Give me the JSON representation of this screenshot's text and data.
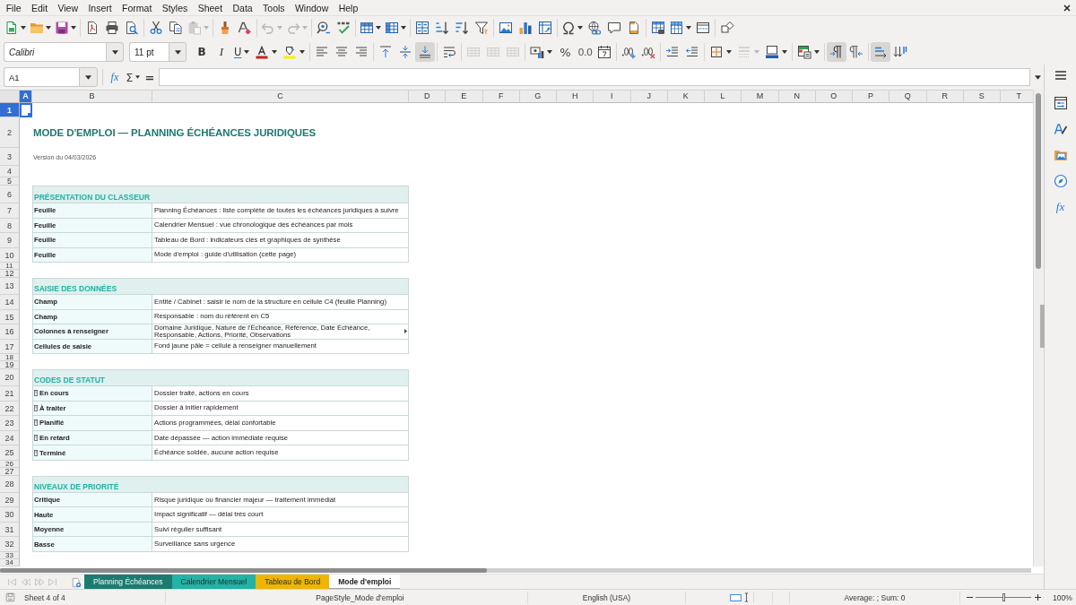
{
  "menu_bar": [
    "File",
    "Edit",
    "View",
    "Insert",
    "Format",
    "Styles",
    "Sheet",
    "Data",
    "Tools",
    "Window",
    "Help"
  ],
  "standard_toolbar": [
    {
      "kind": "split",
      "disabled": false
    },
    {
      "kind": "split",
      "disabled": false
    },
    {
      "kind": "split",
      "disabled": false
    },
    {
      "kind": "button",
      "disabled": false
    },
    {
      "kind": "button",
      "disabled": false
    },
    {
      "kind": "button",
      "disabled": false
    },
    {
      "kind": "button",
      "disabled": false
    },
    {
      "kind": "button",
      "disabled": false
    },
    {
      "kind": "split",
      "disabled": true
    },
    {
      "kind": "button",
      "disabled": false
    },
    {
      "kind": "button",
      "disabled": false
    },
    {
      "kind": "split",
      "disabled": true
    },
    {
      "kind": "split",
      "disabled": true
    },
    {
      "kind": "button",
      "disabled": false
    },
    {
      "kind": "button",
      "disabled": false
    },
    {
      "kind": "split",
      "disabled": false
    },
    {
      "kind": "split",
      "disabled": false
    },
    {
      "kind": "button",
      "disabled": false
    },
    {
      "kind": "button",
      "disabled": false
    },
    {
      "kind": "button",
      "disabled": false
    },
    {
      "kind": "button",
      "disabled": false
    },
    {
      "kind": "button",
      "disabled": false
    },
    {
      "kind": "button",
      "disabled": false
    },
    {
      "kind": "button",
      "disabled": false
    },
    {
      "kind": "split",
      "disabled": false
    },
    {
      "kind": "button",
      "disabled": false
    },
    {
      "kind": "button",
      "disabled": false
    },
    {
      "kind": "button",
      "disabled": false
    },
    {
      "kind": "button",
      "disabled": false
    },
    {
      "kind": "split",
      "disabled": false
    },
    {
      "kind": "button",
      "disabled": false
    },
    {
      "kind": "button",
      "disabled": false
    }
  ],
  "formatting_toolbar": {
    "font_name": "Calibri",
    "font_size": "11 pt",
    "buttons": [
      {
        "kind": "button",
        "label": "B",
        "disabled": false,
        "pressed": false
      },
      {
        "kind": "button",
        "label": "I",
        "disabled": false,
        "pressed": false
      },
      {
        "kind": "split",
        "label": "U",
        "disabled": false,
        "pressed": false
      },
      {
        "kind": "split",
        "disabled": false,
        "pressed": false
      },
      {
        "kind": "split",
        "disabled": false,
        "pressed": false
      },
      {
        "kind": "button",
        "disabled": false,
        "pressed": false
      },
      {
        "kind": "button",
        "disabled": false,
        "pressed": false
      },
      {
        "kind": "button",
        "disabled": false,
        "pressed": false
      },
      {
        "kind": "button",
        "disabled": false,
        "pressed": false
      },
      {
        "kind": "button",
        "disabled": false,
        "pressed": false
      },
      {
        "kind": "button",
        "disabled": false,
        "pressed": true
      },
      {
        "kind": "button",
        "disabled": false,
        "pressed": false
      },
      {
        "kind": "button",
        "disabled": true,
        "pressed": false
      },
      {
        "kind": "button",
        "disabled": true,
        "pressed": false
      },
      {
        "kind": "button",
        "disabled": true,
        "pressed": false
      },
      {
        "kind": "split",
        "disabled": false,
        "pressed": false
      },
      {
        "kind": "button",
        "label": "%",
        "disabled": false,
        "pressed": false
      },
      {
        "kind": "button",
        "label": "0.0",
        "disabled": false,
        "pressed": false
      },
      {
        "kind": "button",
        "disabled": false,
        "pressed": false
      },
      {
        "kind": "button",
        "disabled": false,
        "pressed": false
      },
      {
        "kind": "button",
        "disabled": false,
        "pressed": false
      },
      {
        "kind": "button",
        "disabled": false,
        "pressed": false
      },
      {
        "kind": "button",
        "disabled": false,
        "pressed": false
      },
      {
        "kind": "split",
        "disabled": false,
        "pressed": false
      },
      {
        "kind": "split",
        "disabled": true,
        "pressed": false
      },
      {
        "kind": "split",
        "disabled": false,
        "pressed": false
      },
      {
        "kind": "split",
        "disabled": false,
        "pressed": false
      },
      {
        "kind": "button",
        "disabled": false,
        "pressed": true
      },
      {
        "kind": "button",
        "disabled": false,
        "pressed": false
      },
      {
        "kind": "button",
        "disabled": false,
        "pressed": true
      },
      {
        "kind": "button",
        "disabled": false,
        "pressed": false
      }
    ]
  },
  "formula_bar": {
    "name_box": "A1",
    "function_wizard": "fx",
    "sum": "Σ",
    "equals": "="
  },
  "sheet": {
    "columns": [
      {
        "label": "A",
        "selected": true
      },
      {
        "label": "B",
        "selected": false
      },
      {
        "label": "C",
        "selected": false
      },
      {
        "label": "D",
        "selected": false
      },
      {
        "label": "E",
        "selected": false
      },
      {
        "label": "F",
        "selected": false
      },
      {
        "label": "G",
        "selected": false
      },
      {
        "label": "H",
        "selected": false
      },
      {
        "label": "I",
        "selected": false
      },
      {
        "label": "J",
        "selected": false
      },
      {
        "label": "K",
        "selected": false
      },
      {
        "label": "L",
        "selected": false
      },
      {
        "label": "M",
        "selected": false
      },
      {
        "label": "N",
        "selected": false
      },
      {
        "label": "O",
        "selected": false
      },
      {
        "label": "P",
        "selected": false
      },
      {
        "label": "Q",
        "selected": false
      },
      {
        "label": "R",
        "selected": false
      },
      {
        "label": "S",
        "selected": false
      },
      {
        "label": "T",
        "selected": false
      }
    ],
    "rows": [
      {
        "number": "1",
        "selected": true,
        "kind": "blank"
      },
      {
        "number": "2",
        "selected": false,
        "kind": "title",
        "text": "MODE D'EMPLOI — PLANNING ÉCHÉANCES JURIDIQUES"
      },
      {
        "number": "3",
        "selected": false,
        "kind": "version",
        "text": "Version du 04/03/2026"
      },
      {
        "number": "4",
        "selected": false,
        "kind": "blank"
      },
      {
        "number": "5",
        "selected": false,
        "kind": "blank"
      },
      {
        "number": "6",
        "selected": false,
        "kind": "heading",
        "text": "PRÉSENTATION DU CLASSEUR"
      },
      {
        "number": "7",
        "selected": false,
        "kind": "entry",
        "label": "Feuille",
        "text": "Planning Échéances : liste complète de toutes les échéances juridiques à suivre",
        "overflow": false
      },
      {
        "number": "8",
        "selected": false,
        "kind": "entry",
        "label": "Feuille",
        "text": "Calendrier Mensuel : vue chronologique des échéances par mois",
        "overflow": false
      },
      {
        "number": "9",
        "selected": false,
        "kind": "entry",
        "label": "Feuille",
        "text": "Tableau de Bord : indicateurs clés et graphiques de synthèse",
        "overflow": false
      },
      {
        "number": "10",
        "selected": false,
        "kind": "entry",
        "label": "Feuille",
        "text": "Mode d'emploi : guide d'utilisation (cette page)",
        "overflow": false
      },
      {
        "number": "11",
        "selected": false,
        "kind": "blank"
      },
      {
        "number": "12",
        "selected": false,
        "kind": "blank"
      },
      {
        "number": "13",
        "selected": false,
        "kind": "heading",
        "text": "SAISIE DES DONNÉES"
      },
      {
        "number": "14",
        "selected": false,
        "kind": "entry",
        "label": "Champ",
        "text": "Entité / Cabinet : saisir le nom de la structure en cellule C4 (feuille Planning)",
        "overflow": false
      },
      {
        "number": "15",
        "selected": false,
        "kind": "entry",
        "label": "Champ",
        "text": "Responsable : nom du référent en C5",
        "overflow": false
      },
      {
        "number": "16",
        "selected": false,
        "kind": "entry",
        "label": "Colonnes à renseigner",
        "text": "Domaine Juridique, Nature de l'Échéance, Référence, Date Échéance, Responsable, Actions, Priorité, Observations",
        "overflow": true
      },
      {
        "number": "17",
        "selected": false,
        "kind": "entry",
        "label": "Cellules de saisie",
        "text": "Fond jaune pâle = cellule à renseigner manuellement",
        "overflow": false
      },
      {
        "number": "18",
        "selected": false,
        "kind": "blank"
      },
      {
        "number": "19",
        "selected": false,
        "kind": "blank"
      },
      {
        "number": "20",
        "selected": false,
        "kind": "heading",
        "text": "CODES DE STATUT"
      },
      {
        "number": "21",
        "selected": false,
        "kind": "status",
        "label": "En cours",
        "text": "Dossier traité, actions en cours",
        "overflow": false
      },
      {
        "number": "22",
        "selected": false,
        "kind": "status",
        "label": "À traiter",
        "text": "Dossier à initier rapidement",
        "overflow": false
      },
      {
        "number": "23",
        "selected": false,
        "kind": "status",
        "label": "Planifié",
        "text": "Actions programmées, délai confortable",
        "overflow": false
      },
      {
        "number": "24",
        "selected": false,
        "kind": "status",
        "label": "En retard",
        "text": "Date dépassée — action immédiate requise",
        "overflow": false
      },
      {
        "number": "25",
        "selected": false,
        "kind": "status",
        "label": "Terminé",
        "text": "Échéance soldée, aucune action requise",
        "overflow": false
      },
      {
        "number": "26",
        "selected": false,
        "kind": "blank"
      },
      {
        "number": "27",
        "selected": false,
        "kind": "blank"
      },
      {
        "number": "28",
        "selected": false,
        "kind": "heading",
        "text": "NIVEAUX DE PRIORITÉ"
      },
      {
        "number": "29",
        "selected": false,
        "kind": "entry",
        "label": "Critique",
        "text": "Risque juridique ou financier majeur — traitement immédiat",
        "overflow": false
      },
      {
        "number": "30",
        "selected": false,
        "kind": "entry",
        "label": "Haute",
        "text": "Impact significatif — délai très court",
        "overflow": false
      },
      {
        "number": "31",
        "selected": false,
        "kind": "entry",
        "label": "Moyenne",
        "text": "Suivi régulier suffisant",
        "overflow": false
      },
      {
        "number": "32",
        "selected": false,
        "kind": "entry",
        "label": "Basse",
        "text": "Surveillance sans urgence",
        "overflow": false
      },
      {
        "number": "33",
        "selected": false,
        "kind": "blank"
      },
      {
        "number": "34",
        "selected": false,
        "kind": "blank"
      }
    ]
  },
  "sidebar": {
    "functions": "fx"
  },
  "sheet_tabs": {
    "navigation": [
      {
        "disabled": true
      },
      {
        "disabled": true
      },
      {
        "disabled": true
      },
      {
        "disabled": true
      }
    ],
    "tabs": [
      {
        "label": "Planning Échéances",
        "color": "#1b7b70",
        "selected": false
      },
      {
        "label": "Calendrier Mensuel",
        "color": "#22b3a6",
        "selected": false
      },
      {
        "label": "Tableau de Bord",
        "color": "#efb500",
        "selected": false
      },
      {
        "label": "Mode d'emploi",
        "selected": true
      }
    ]
  },
  "status_bar": {
    "sheet_position": "Sheet 4 of 4",
    "page_style": "PageStyle_Mode d'emploi",
    "language": "English (USA)",
    "selection_summary": "Average: ; Sum: 0",
    "zoom": {
      "level": 0.5,
      "reading": "100%"
    }
  }
}
